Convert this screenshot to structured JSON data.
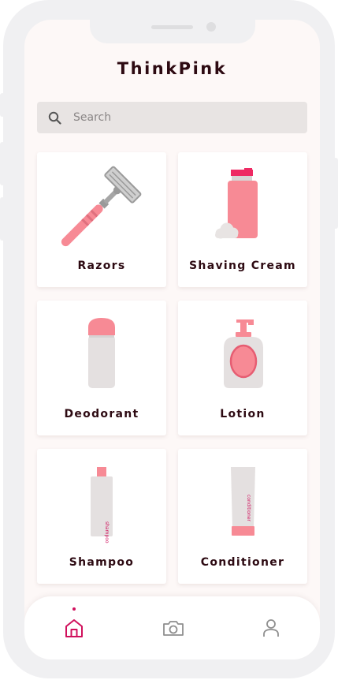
{
  "app": {
    "title": "ThinkPink"
  },
  "search": {
    "placeholder": "Search",
    "icon": "search-icon"
  },
  "categories": [
    {
      "label": "Razors",
      "icon": "razor-icon"
    },
    {
      "label": "Shaving Cream",
      "icon": "shaving-cream-icon"
    },
    {
      "label": "Deodorant",
      "icon": "deodorant-icon"
    },
    {
      "label": "Lotion",
      "icon": "lotion-icon"
    },
    {
      "label": "Shampoo",
      "icon": "shampoo-icon",
      "bottle_text": "shampoo"
    },
    {
      "label": "Conditioner",
      "icon": "conditioner-icon",
      "bottle_text": "conditioner"
    }
  ],
  "tabbar": {
    "active": "home",
    "items": [
      {
        "name": "home",
        "icon": "home-icon"
      },
      {
        "name": "camera",
        "icon": "camera-icon"
      },
      {
        "name": "profile",
        "icon": "user-icon"
      }
    ]
  },
  "colors": {
    "accent": "#d0105c",
    "pink": "#f78a95",
    "grey": "#e4e0e0",
    "background": "#fdf8f7",
    "text": "#2d0a12"
  }
}
